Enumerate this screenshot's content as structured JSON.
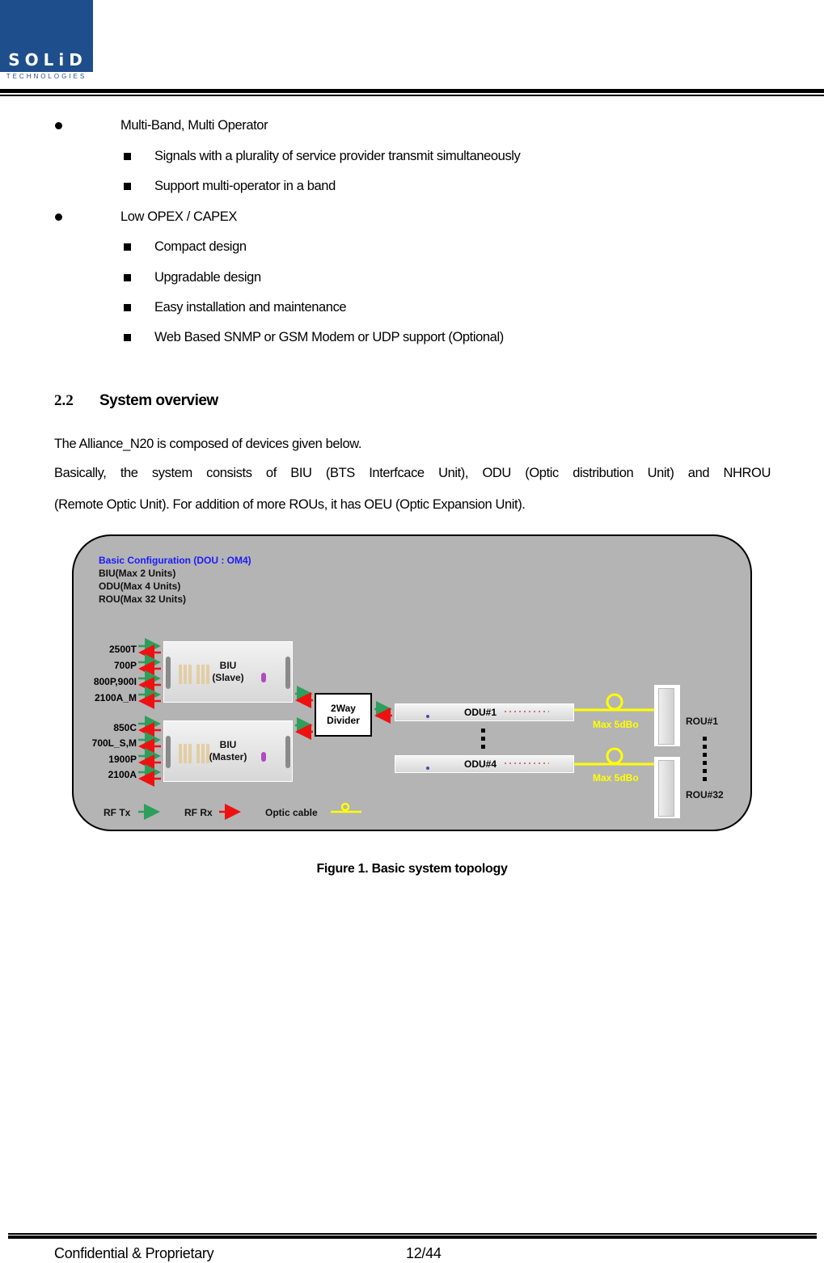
{
  "header": {
    "logo": {
      "word": "SOLiD",
      "subtitle": "TECHNOLOGIES"
    }
  },
  "features": [
    {
      "label": "Multi-Band, Multi Operator",
      "sub": [
        "Signals with a plurality of service provider transmit simultaneously",
        "Support multi-operator in a band"
      ]
    },
    {
      "label": "Low OPEX / CAPEX",
      "sub": [
        "Compact design",
        "Upgradable design",
        "Easy installation and maintenance",
        "Web Based SNMP or GSM Modem or UDP support (Optional)"
      ]
    }
  ],
  "section": {
    "number": "2.2",
    "title": "System overview",
    "paragraphs": [
      "The Alliance_N20 is composed of devices given below.",
      "Basically, the system consists of BIU (BTS Interfcace Unit), ODU (Optic distribution Unit) and NHROU",
      "(Remote Optic Unit). For addition of more ROUs, it has OEU (Optic Expansion Unit)."
    ]
  },
  "diagram": {
    "config_title": "Basic Configuration (DOU : OM4)",
    "config_lines": [
      "BIU(Max 2 Units)",
      "ODU(Max 4 Units)",
      "ROU(Max 32 Units)"
    ],
    "biu_slave": {
      "line1": "BIU",
      "line2": "(Slave)",
      "bands": [
        "2500T",
        "700P",
        "800P,900I",
        "2100A_M"
      ]
    },
    "biu_master": {
      "line1": "BIU",
      "line2": "(Master)",
      "bands": [
        "850C",
        "700L_S,M",
        "1900P",
        "2100A"
      ]
    },
    "divider": {
      "line1": "2Way",
      "line2": "Divider"
    },
    "odus": [
      "ODU#1",
      "ODU#4"
    ],
    "optic_labels": [
      "Max 5dBo",
      "Max 5dBo"
    ],
    "rous": [
      "ROU#1",
      "ROU#32"
    ],
    "legend": {
      "tx": "RF Tx",
      "rx": "RF Rx",
      "optic": "Optic cable"
    },
    "colors": {
      "tx": "#2e9e5b",
      "rx": "#ee1111",
      "optic": "#ffff00",
      "config_title": "#1a1aff",
      "background": "#b4b4b4"
    }
  },
  "caption": "Figure 1. Basic system topology",
  "footer": {
    "left": "Confidential & Proprietary",
    "page": "12/44"
  }
}
